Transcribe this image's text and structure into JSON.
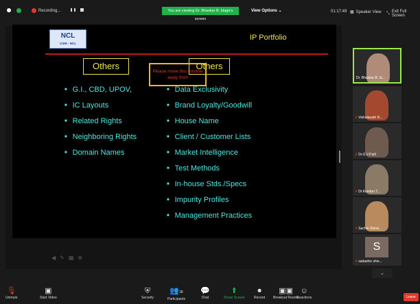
{
  "topbar": {
    "recording_label": "Recording...",
    "banner": "You are viewing Dr. Bhaskar B. Idage's screen",
    "view_options": "View Options",
    "time": "01:17:49",
    "speaker_view": "Speaker View",
    "exit_full": "Exit Full Screen"
  },
  "slide": {
    "logo_text": "NCL",
    "logo_sub": "CSIR - NCL",
    "title": "IP Portfolio",
    "floating_note": "Please move this window away from",
    "left_header": "Others",
    "right_header": "Others",
    "left_items": [
      "G.I., CBD, UPOV,",
      "IC Layouts",
      "Related Rights",
      "Neighboring Rights",
      "Domain Names"
    ],
    "right_items": [
      "Data Exclusivity",
      "Brand Loyalty/Goodwill",
      "House Name",
      "Client / Customer Lists",
      "Market Intelligence",
      "Test Methods",
      "In-house Stds./Specs",
      "Impurity Profiles",
      "Management Practices"
    ]
  },
  "participants": [
    {
      "name": "Dr. Bhaskar B. Id...",
      "active": true
    },
    {
      "name": "Vishalanath R...",
      "active": false
    },
    {
      "name": "Dr.G.V.Patil",
      "active": false
    },
    {
      "name": "Dr.Kundan T...",
      "active": false
    },
    {
      "name": "Sachin Shind...",
      "active": false
    },
    {
      "name": "sadashiv shin...",
      "initial": "S",
      "active": false
    }
  ],
  "bottombar": {
    "unmute": "Unmute",
    "start_video": "Start Video",
    "security": "Security",
    "participants": "Participants",
    "participants_count": "38",
    "chat": "Chat",
    "share_screen": "Share Screen",
    "record": "Record",
    "breakout": "Breakout Rooms",
    "reactions": "Reactions",
    "leave": "Leave"
  }
}
